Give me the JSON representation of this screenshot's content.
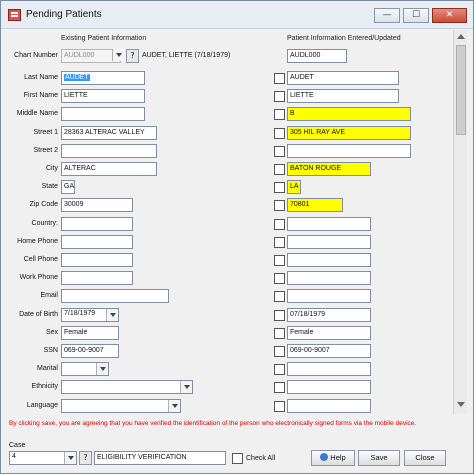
{
  "window": {
    "title": "Pending Patients",
    "minimize": "—",
    "maximize": "☐",
    "close": "✕"
  },
  "headers": {
    "existing": "Existing Patient Information",
    "entered": "Patient Information Entered/Updated"
  },
  "chart_number": {
    "label": "Chart Number",
    "existing_value": "AUDL000",
    "patient_summary": "AUDET, LIETTE (7/18/1979)",
    "entered_value": "AUDL000"
  },
  "fields": [
    {
      "label": "Last Name",
      "existing": "AUDET",
      "entered": "AUDET"
    },
    {
      "label": "First Name",
      "existing": "LIETTE",
      "entered": "LIETTE"
    },
    {
      "label": "Middle Name",
      "existing": "",
      "entered": "B"
    },
    {
      "label": "Street 1",
      "existing": "28363 ALTERAC VALLEY",
      "entered": "305 HIL RAY AVE"
    },
    {
      "label": "Street 2",
      "existing": "",
      "entered": ""
    },
    {
      "label": "City",
      "existing": "ALTERAC",
      "entered": "BATON ROUGE"
    },
    {
      "label": "State",
      "existing": "GA",
      "entered": "LA"
    },
    {
      "label": "Zip Code",
      "existing": "30009",
      "entered": "70801"
    },
    {
      "label": "Country:",
      "existing": "",
      "entered": ""
    },
    {
      "label": "Home Phone",
      "existing": "",
      "entered": ""
    },
    {
      "label": "Cell Phone",
      "existing": "",
      "entered": ""
    },
    {
      "label": "Work Phone",
      "existing": "",
      "entered": ""
    },
    {
      "label": "Email",
      "existing": "",
      "entered": ""
    },
    {
      "label": "Date of Birth",
      "existing": "7/18/1979",
      "entered": "07/18/1979"
    },
    {
      "label": "Sex",
      "existing": "Female",
      "entered": "Female"
    },
    {
      "label": "SSN",
      "existing": "069-00-9007",
      "entered": "069-00-9007"
    },
    {
      "label": "Marital",
      "existing": "",
      "entered": ""
    },
    {
      "label": "Ethnicity",
      "existing": "",
      "entered": ""
    },
    {
      "label": "Language",
      "existing": "",
      "entered": ""
    }
  ],
  "footer": {
    "notice": "By clicking save, you are agreeing that you have verified the identification of the person who electronically signed forms via the mobile device.",
    "case_label": "Case",
    "case_value": "4",
    "case_description": "ELIGIBILITY VERIFICATION",
    "check_all_label": "Check All",
    "help_label": "Help",
    "save_label": "Save",
    "close_label": "Close"
  },
  "colors": {
    "highlight_changed": "#ffff00",
    "notice_text": "#d40000",
    "selection": "#3399ff"
  }
}
